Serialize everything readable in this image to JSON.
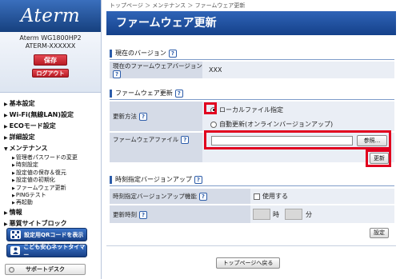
{
  "sidebar": {
    "logo": "Aterm",
    "model": "Aterm WG1800HP2",
    "device_id": "ATERM-XXXXXX",
    "save_label": "保存",
    "logout_label": "ログアウト",
    "menu": [
      "基本設定",
      "Wi-Fi(無線LAN)設定",
      "ECOモード設定",
      "詳細設定",
      "メンテナンス"
    ],
    "maintenance_items": [
      "管理者パスワードの変更",
      "時刻設定",
      "設定値の保存＆復元",
      "設定値の初期化",
      "ファームウェア更新",
      "PINGテスト",
      "再起動"
    ],
    "menu_after": [
      "情報",
      "悪質サイトブロック"
    ],
    "qr_button": "設定用QRコードを表示",
    "kids_button": "こども安心ネットタイマー",
    "support_button": "サポートデスク"
  },
  "breadcrumb": "トップページ ＞ メンテナンス ＞ ファームウェア更新",
  "page_title": "ファームウェア更新",
  "help_mark": "?",
  "current_version": {
    "heading": "現在のバージョン",
    "label": "現在のファームウェアバージョン",
    "value": "XXX"
  },
  "firmware_update": {
    "heading": "ファームウェア更新",
    "method_label": "更新方法",
    "option_local": "ローカルファイル指定",
    "option_online": "自動更新(オンラインバージョンアップ)",
    "selected": "ローカルファイル指定",
    "file_label": "ファームウェアファイル",
    "file_value": "",
    "browse_label": "参照...",
    "update_label": "更新"
  },
  "scheduled": {
    "heading": "時刻指定バージョンアップ",
    "feature_label": "時刻指定バージョンアップ機能",
    "use_label": "使用する",
    "use_checked": false,
    "time_label": "更新時刻",
    "hour_value": "",
    "hour_unit": "時",
    "minute_value": "",
    "minute_unit": "分",
    "set_label": "設定"
  },
  "back_label": "トップページへ戻る",
  "colors": {
    "brand_blue": "#1f4f9c",
    "highlight_red": "#e1001e",
    "button_red": "#c8232c"
  }
}
